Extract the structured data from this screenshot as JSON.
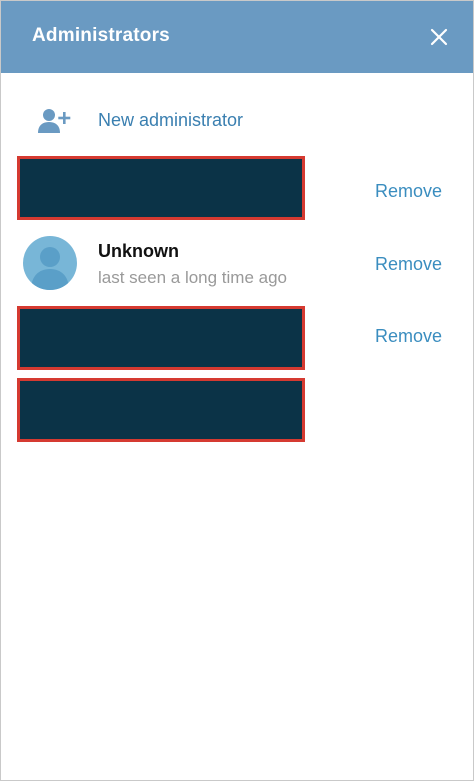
{
  "header": {
    "title": "Administrators",
    "close_icon": "close-icon"
  },
  "new_admin": {
    "label": "New administrator",
    "icon": "add-user-icon"
  },
  "admins": [
    {
      "redacted": true,
      "action": "Remove"
    },
    {
      "redacted": false,
      "name": "Unknown",
      "status": "last seen a long time ago",
      "action": "Remove",
      "avatar": "avatar-placeholder-icon"
    },
    {
      "redacted": true,
      "action": "Remove"
    },
    {
      "redacted": true
    }
  ],
  "colors": {
    "header_bg": "#6a9ac2",
    "accent": "#3a8dbf",
    "redaction_fill": "#0b3347",
    "redaction_border": "#d53a31",
    "avatar_bg": "#78b6d7"
  }
}
